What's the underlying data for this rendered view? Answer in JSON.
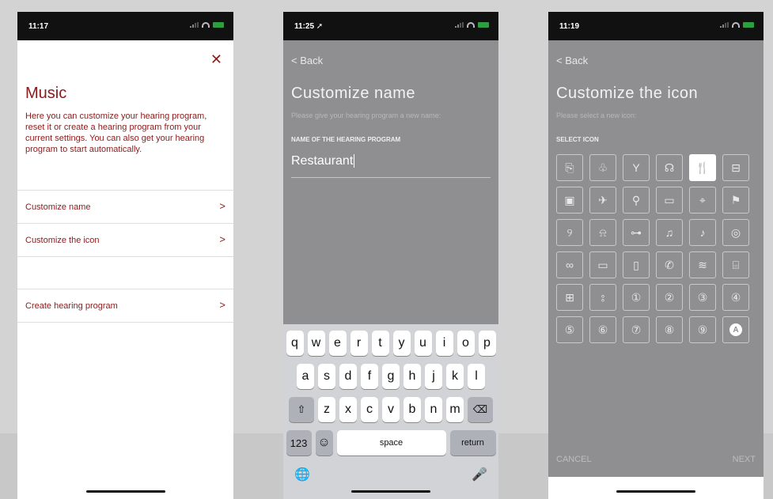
{
  "phone1": {
    "status_time": "11:17",
    "close_icon": "close-icon",
    "title": "Music",
    "description": "Here you can customize your hearing program, reset it or create a hearing program from your current settings. You can also get your hearing program to start automatically.",
    "menu": [
      {
        "label": "Customize name",
        "chevron": ">"
      },
      {
        "label": "Customize the icon",
        "chevron": ">"
      },
      {
        "label": "Create hearing program",
        "chevron": ">"
      }
    ],
    "accent_color": "#8b1a1a"
  },
  "phone2": {
    "status_time": "11:25 ➚",
    "back": "< Back",
    "title": "Customize name",
    "subtitle": "Please give your hearing program a new name:",
    "field_label": "NAME OF THE HEARING PROGRAM",
    "field_value": "Restaurant",
    "keyboard": {
      "row1": [
        "q",
        "w",
        "e",
        "r",
        "t",
        "y",
        "u",
        "i",
        "o",
        "p"
      ],
      "row2": [
        "a",
        "s",
        "d",
        "f",
        "g",
        "h",
        "j",
        "k",
        "l"
      ],
      "row3": [
        "z",
        "x",
        "c",
        "v",
        "b",
        "n",
        "m"
      ],
      "shift": "⇧",
      "delete": "⌫",
      "numbers": "123",
      "emoji": "☺",
      "space": "space",
      "return": "return",
      "globe": "🌐",
      "mic": "🎤"
    }
  },
  "phone3": {
    "status_time": "11:19",
    "back": "< Back",
    "title": "Customize the icon",
    "subtitle": "Please select a new icon:",
    "section_label": "SELECT ICON",
    "icons": [
      {
        "name": "headphones-icon",
        "glyph": "⎘"
      },
      {
        "name": "tree-icon",
        "glyph": "♧"
      },
      {
        "name": "cocktail-icon",
        "glyph": "Y"
      },
      {
        "name": "head-icon",
        "glyph": "☊"
      },
      {
        "name": "fork-knife-icon",
        "glyph": "🍴"
      },
      {
        "name": "car-icon",
        "glyph": "⊟"
      },
      {
        "name": "bus-icon",
        "glyph": "▣"
      },
      {
        "name": "plane-icon",
        "glyph": "✈"
      },
      {
        "name": "bicycle-icon",
        "glyph": "⚲"
      },
      {
        "name": "briefcase-icon",
        "glyph": "▭"
      },
      {
        "name": "location-icon",
        "glyph": "⌖"
      },
      {
        "name": "runner-icon",
        "glyph": "⚑"
      },
      {
        "name": "ear-icon",
        "glyph": "୨"
      },
      {
        "name": "conversation-icon",
        "glyph": "⍾"
      },
      {
        "name": "dumbbell-icon",
        "glyph": "⊶"
      },
      {
        "name": "music-icon",
        "glyph": "♫"
      },
      {
        "name": "guitar-icon",
        "glyph": "♪"
      },
      {
        "name": "speaker-icon",
        "glyph": "◎"
      },
      {
        "name": "glasses-icon",
        "glyph": "∞"
      },
      {
        "name": "monitor-icon",
        "glyph": "▭"
      },
      {
        "name": "phone-icon",
        "glyph": "▯"
      },
      {
        "name": "telephone-icon",
        "glyph": "✆"
      },
      {
        "name": "waves-icon",
        "glyph": "≋"
      },
      {
        "name": "picture-icon",
        "glyph": "⌸"
      },
      {
        "name": "waveform-icon",
        "glyph": "⊞"
      },
      {
        "name": "hearing-icon",
        "glyph": "⦂"
      },
      {
        "name": "number-1-icon",
        "glyph": "①"
      },
      {
        "name": "number-2-icon",
        "glyph": "②"
      },
      {
        "name": "number-3-icon",
        "glyph": "③"
      },
      {
        "name": "number-4-icon",
        "glyph": "④"
      },
      {
        "name": "number-5-icon",
        "glyph": "⑤"
      },
      {
        "name": "number-6-icon",
        "glyph": "⑥"
      },
      {
        "name": "number-7-icon",
        "glyph": "⑦"
      },
      {
        "name": "number-8-icon",
        "glyph": "⑧"
      },
      {
        "name": "number-9-icon",
        "glyph": "⑨"
      },
      {
        "name": "letter-a-icon",
        "glyph": "A"
      }
    ],
    "selected_icon": "fork-knife-icon",
    "cancel": "CANCEL",
    "next": "NEXT"
  }
}
